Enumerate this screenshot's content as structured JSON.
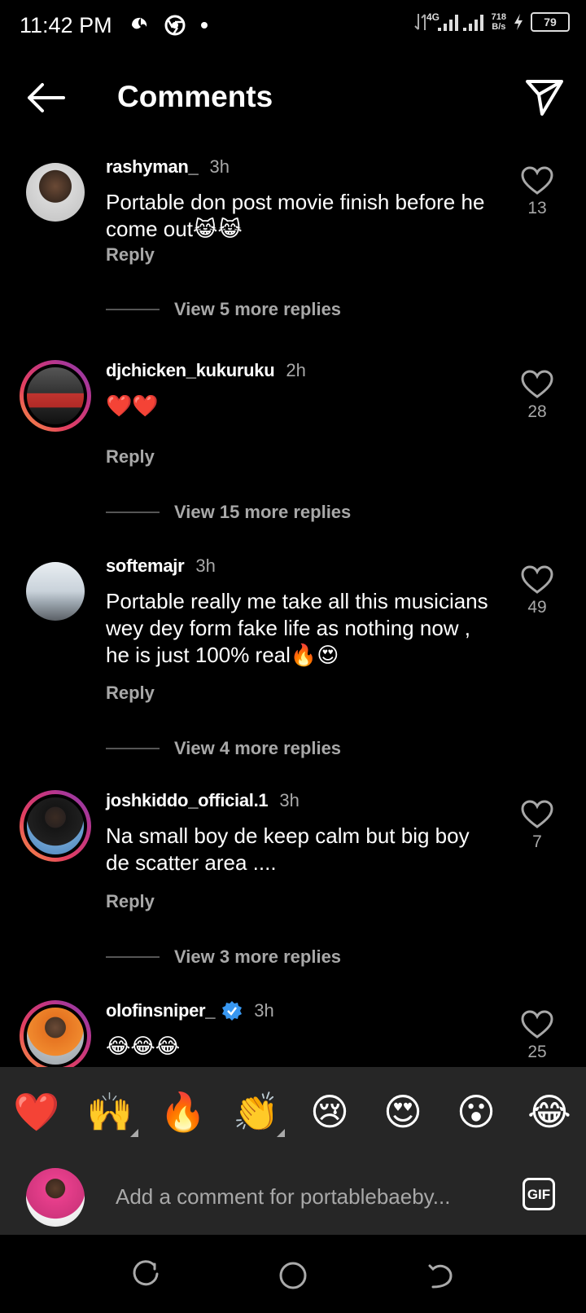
{
  "status_bar": {
    "time": "11:42 PM",
    "network": "4G",
    "speed_value": "718",
    "speed_unit": "B/s",
    "battery": "79"
  },
  "header": {
    "title": "Comments"
  },
  "comments": [
    {
      "username": "rashyman_",
      "time": "3h",
      "text": "Portable don post movie finish before he come out😹😹",
      "reply": "Reply",
      "likes": "13",
      "view_replies": "View 5 more replies",
      "ring": false,
      "verified": false
    },
    {
      "username": "djchicken_kukuruku",
      "time": "2h",
      "text": "❤️❤️",
      "reply": "Reply",
      "likes": "28",
      "view_replies": "View 15 more replies",
      "ring": true,
      "verified": false
    },
    {
      "username": "softemajr",
      "time": "3h",
      "text": "Portable really me take all this musicians wey dey form fake life as nothing now , he is just 100% real🔥😍",
      "reply": "Reply",
      "likes": "49",
      "view_replies": "View 4 more replies",
      "ring": false,
      "verified": false
    },
    {
      "username": "joshkiddo_official.1",
      "time": "3h",
      "text": "Na small boy de keep calm but big boy de scatter area ....",
      "reply": "Reply",
      "likes": "7",
      "view_replies": "View 3 more replies",
      "ring": true,
      "verified": false
    },
    {
      "username": "olofinsniper_",
      "time": "3h",
      "text": "😂😂😂",
      "likes": "25",
      "ring": true,
      "verified": true
    }
  ],
  "emoji_bar": {
    "emojis": [
      "❤️",
      "🙌",
      "🔥",
      "👏",
      "😢",
      "😍",
      "😮",
      "😂"
    ]
  },
  "input": {
    "placeholder": "Add a comment for portablebaeby...",
    "gif_label": "GIF"
  },
  "colors": {
    "background": "#000000",
    "secondary_text": "#a8a8a8",
    "panel": "#262626",
    "verified_blue": "#3897f0"
  }
}
